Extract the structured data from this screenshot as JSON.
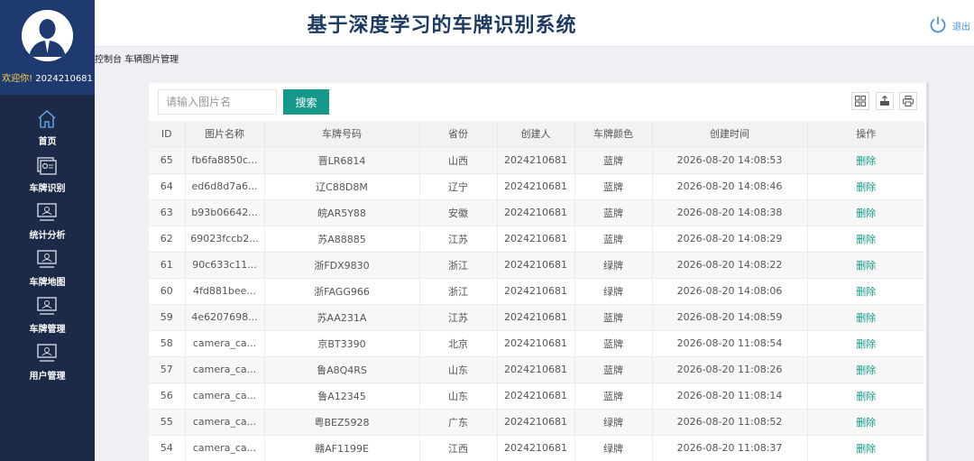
{
  "app": {
    "title": "基于深度学习的车牌识别系统",
    "logout_label": "退出"
  },
  "user": {
    "welcome": "欢迎你!",
    "username": "2024210681"
  },
  "sidebar": {
    "items": [
      {
        "label": "首页",
        "icon": "home-icon"
      },
      {
        "label": "车牌识别",
        "icon": "recognition-icon"
      },
      {
        "label": "统计分析",
        "icon": "statistics-icon"
      },
      {
        "label": "车牌地图",
        "icon": "map-icon"
      },
      {
        "label": "车牌管理",
        "icon": "plate-manage-icon"
      },
      {
        "label": "用户管理",
        "icon": "user-manage-icon"
      }
    ]
  },
  "breadcrumb": {
    "items": [
      "控制台",
      "车辆图片管理"
    ]
  },
  "search": {
    "placeholder": "请输入图片名",
    "button_label": "搜索"
  },
  "table": {
    "columns": [
      "ID",
      "图片名称",
      "车牌号码",
      "省份",
      "创建人",
      "车牌颜色",
      "创建时间",
      "操作"
    ],
    "rows": [
      {
        "id": "65",
        "name": "fb6fa8850c...",
        "plate": "晋LR6814",
        "province": "山西",
        "creator": "2024210681",
        "color": "蓝牌",
        "time": "2026-08-20 14:08:53",
        "action": "删除"
      },
      {
        "id": "64",
        "name": "ed6d8d7a6...",
        "plate": "辽C88D8M",
        "province": "辽宁",
        "creator": "2024210681",
        "color": "蓝牌",
        "time": "2026-08-20 14:08:46",
        "action": "删除"
      },
      {
        "id": "63",
        "name": "b93b06642...",
        "plate": "皖AR5Y88",
        "province": "安徽",
        "creator": "2024210681",
        "color": "蓝牌",
        "time": "2026-08-20 14:08:38",
        "action": "删除"
      },
      {
        "id": "62",
        "name": "69023fccb2...",
        "plate": "苏A88885",
        "province": "江苏",
        "creator": "2024210681",
        "color": "蓝牌",
        "time": "2026-08-20 14:08:29",
        "action": "删除"
      },
      {
        "id": "61",
        "name": "90c633c11...",
        "plate": "浙FDX9830",
        "province": "浙江",
        "creator": "2024210681",
        "color": "绿牌",
        "time": "2026-08-20 14:08:22",
        "action": "删除"
      },
      {
        "id": "60",
        "name": "4fd881bee...",
        "plate": "浙FAGG966",
        "province": "浙江",
        "creator": "2024210681",
        "color": "绿牌",
        "time": "2026-08-20 14:08:06",
        "action": "删除"
      },
      {
        "id": "59",
        "name": "4e6207698...",
        "plate": "苏AA231A",
        "province": "江苏",
        "creator": "2024210681",
        "color": "蓝牌",
        "time": "2026-08-20 14:08:59",
        "action": "删除"
      },
      {
        "id": "58",
        "name": "camera_ca...",
        "plate": "京BT3390",
        "province": "北京",
        "creator": "2024210681",
        "color": "蓝牌",
        "time": "2026-08-20 11:08:54",
        "action": "删除"
      },
      {
        "id": "57",
        "name": "camera_ca...",
        "plate": "鲁A8Q4RS",
        "province": "山东",
        "creator": "2024210681",
        "color": "蓝牌",
        "time": "2026-08-20 11:08:26",
        "action": "删除"
      },
      {
        "id": "56",
        "name": "camera_ca...",
        "plate": "鲁A12345",
        "province": "山东",
        "creator": "2024210681",
        "color": "蓝牌",
        "time": "2026-08-20 11:08:14",
        "action": "删除"
      },
      {
        "id": "55",
        "name": "camera_ca...",
        "plate": "粤BEZ5928",
        "province": "广东",
        "creator": "2024210681",
        "color": "绿牌",
        "time": "2026-08-20 11:08:52",
        "action": "删除"
      },
      {
        "id": "54",
        "name": "camera_ca...",
        "plate": "赣AF1199E",
        "province": "江西",
        "creator": "2024210681",
        "color": "绿牌",
        "time": "2026-08-20 11:08:37",
        "action": "删除"
      }
    ]
  },
  "toolbar": {
    "icons": [
      "columns-icon",
      "export-icon",
      "print-icon"
    ]
  },
  "colors": {
    "sidebar_bg": "#1c2a48",
    "accent": "#16998a",
    "title": "#1f3a5f"
  }
}
